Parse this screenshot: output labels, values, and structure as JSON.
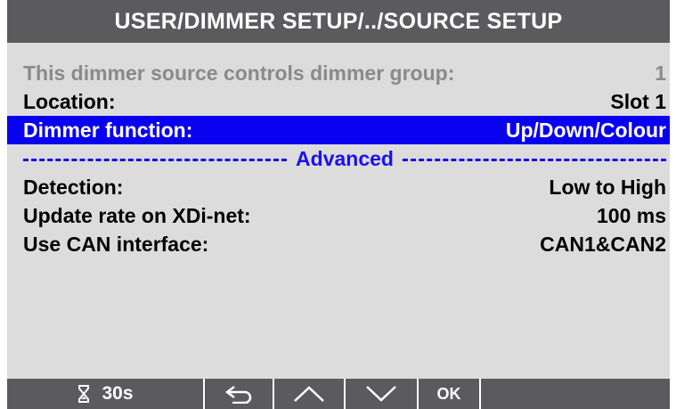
{
  "header": {
    "title": "USER/DIMMER SETUP/../SOURCE SETUP"
  },
  "rows": [
    {
      "label": "This dimmer source controls dimmer group:",
      "value": "1"
    },
    {
      "label": "Location:",
      "value": "Slot 1"
    },
    {
      "label": "Dimmer function:",
      "value": "Up/Down/Colour"
    }
  ],
  "section": {
    "label": "Advanced"
  },
  "advanced_rows": [
    {
      "label": "Detection:",
      "value": "Low to High"
    },
    {
      "label": "Update rate on XDi-net:",
      "value": "100 ms"
    },
    {
      "label": "Use CAN interface:",
      "value": "CAN1&CAN2"
    }
  ],
  "footer": {
    "timer_value": "30s",
    "ok_label": "OK",
    "icons": {
      "timer": "hourglass-icon",
      "back": "back-arrow-icon",
      "up": "chevron-up-icon",
      "down": "chevron-down-icon"
    }
  },
  "colors": {
    "title_bar": "#5b5b5d",
    "screen_bg": "#dcdcdc",
    "selected_bg": "#0a00f0",
    "accent_blue": "#1a10f0",
    "dim_text": "#8a8a8a"
  }
}
